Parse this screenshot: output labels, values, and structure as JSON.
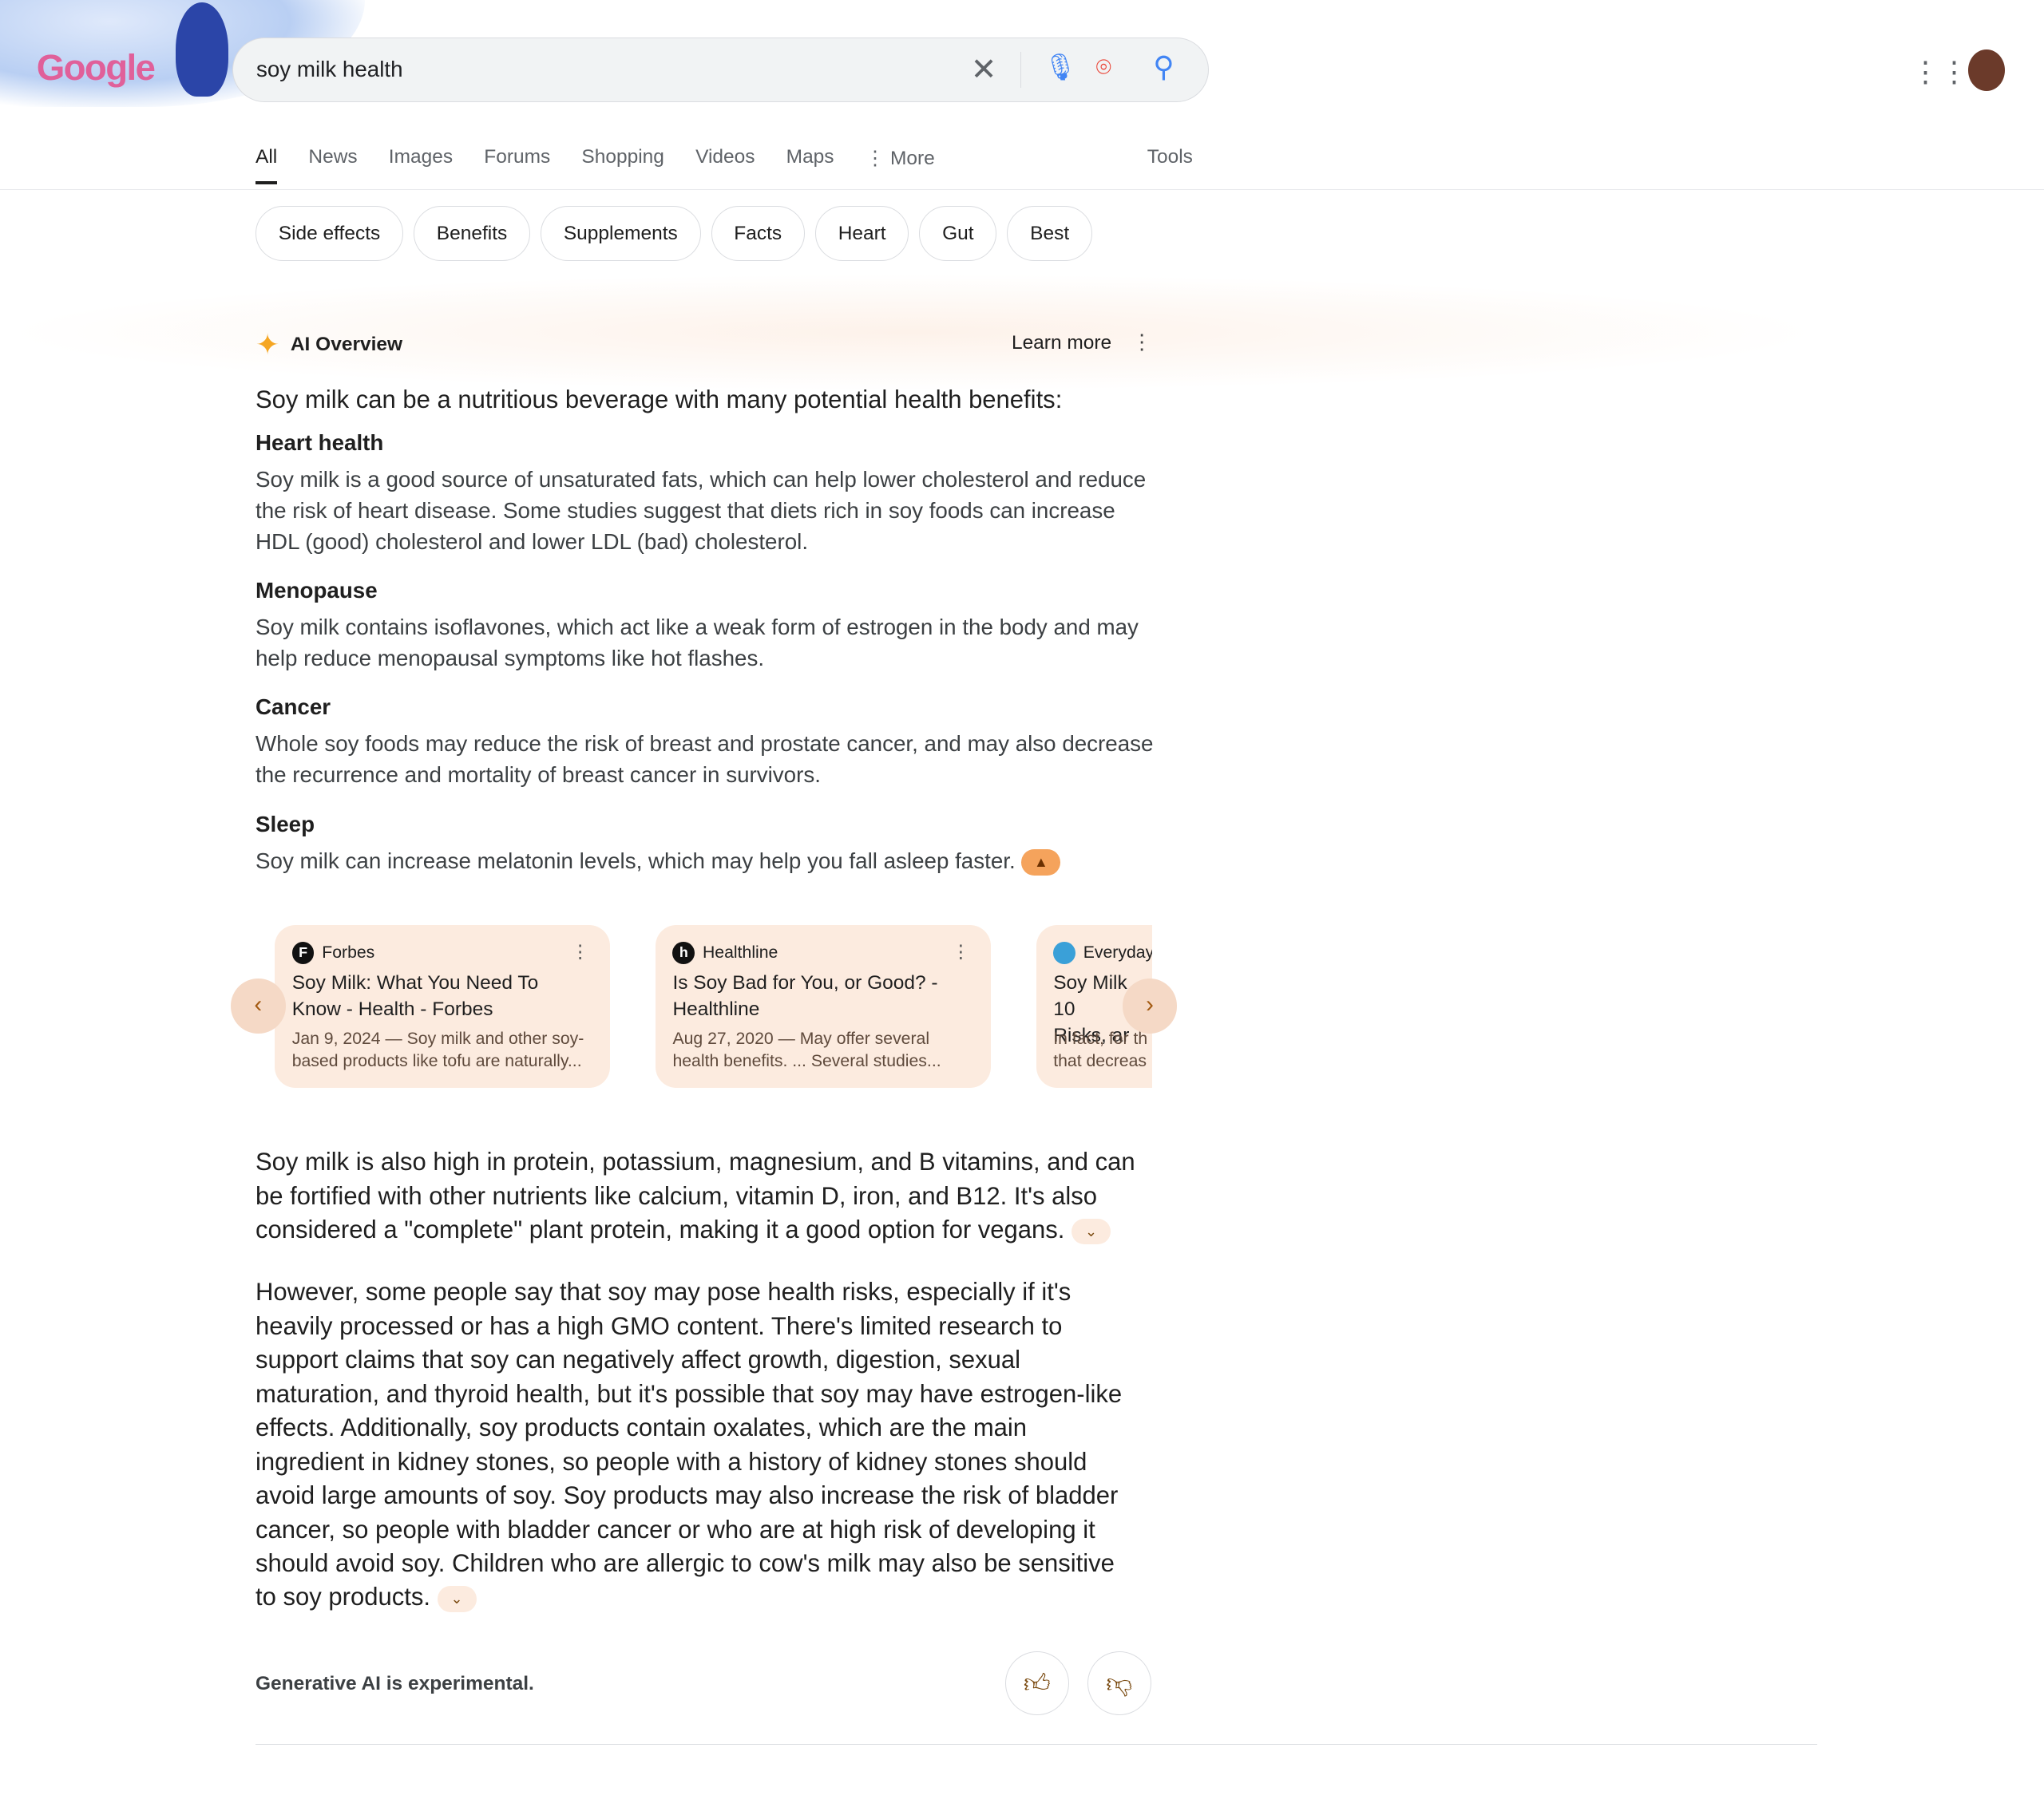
{
  "header": {
    "logo_text": "Google",
    "query": "soy milk health",
    "icons": [
      "close-icon",
      "mic-icon",
      "lens-icon",
      "search-icon",
      "apps-icon",
      "avatar"
    ]
  },
  "tabs": [
    "All",
    "News",
    "Images",
    "Forums",
    "Shopping",
    "Videos",
    "Maps",
    "More"
  ],
  "tools": "Tools",
  "chips": [
    "Side effects",
    "Benefits",
    "Supplements",
    "Facts",
    "Heart",
    "Gut",
    "Best"
  ],
  "ai": {
    "title": "AI Overview",
    "learn_more": "Learn more",
    "intro": "Soy milk can be a nutritious beverage with many potential health benefits:",
    "sections": [
      {
        "h": "Heart health",
        "p": "Soy milk is a good source of unsaturated fats, which can help lower cholesterol and reduce the risk of heart disease. Some studies suggest that diets rich in soy foods can increase HDL (good) cholesterol and lower LDL (bad) cholesterol."
      },
      {
        "h": "Menopause",
        "p": "Soy milk contains isoflavones, which act like a weak form of estrogen in the body and may help reduce menopausal symptoms like hot flashes."
      },
      {
        "h": "Cancer",
        "p": "Whole soy foods may reduce the risk of breast and prostate cancer, and may also decrease the recurrence and mortality of breast cancer in survivors."
      },
      {
        "h": "Sleep",
        "p": "Soy milk can increase melatonin levels, which may help you fall asleep faster."
      }
    ],
    "cards": [
      {
        "source": "Forbes",
        "fav": "F",
        "title": "Soy Milk: What You Need To Know - Health - Forbes",
        "desc": "Jan 9, 2024 — Soy milk and other soy-based products like tofu are naturally..."
      },
      {
        "source": "Healthline",
        "fav": "h",
        "title": "Is Soy Bad for You, or Good? - Healthline",
        "desc": "Aug 27, 2020 — May offer several health benefits. ... Several studies..."
      },
      {
        "source": "Everyday",
        "fav": "",
        "title": "Soy Milk 10 Risks, ar",
        "desc": "In fact, for th that decreas"
      }
    ],
    "para1": "Soy milk is also high in protein, potassium, magnesium, and B vitamins, and can be fortified with other nutrients like calcium, vitamin D, iron, and B12. It's also considered a \"complete\" plant protein, making it a good option for vegans.",
    "para2": "However, some people say that soy may pose health risks, especially if it's heavily processed or has a high GMO content. There's limited research to support claims that soy can negatively affect growth, digestion, sexual maturation, and thyroid health, but it's possible that soy may have estrogen-like effects. Additionally, soy products contain oxalates, which are the main ingredient in kidney stones, so people with a history of kidney stones should avoid large amounts of soy. Soy products may also increase the risk of bladder cancer, so people with bladder cancer or who are at high risk of developing it should avoid soy. Children who are allergic to cow's milk may also be sensitive to soy products.",
    "disclaimer": "Generative AI is experimental."
  },
  "colors": {
    "card_bg": "#fcebdf",
    "accent": "#f5a35c"
  }
}
